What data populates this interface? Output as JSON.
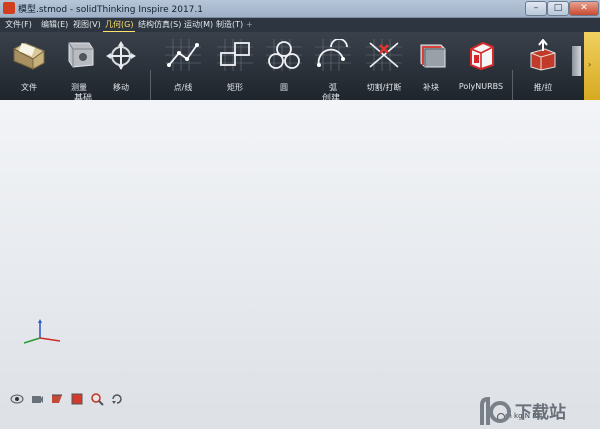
{
  "window": {
    "title": "模型.stmod - solidThinking Inspire 2017.1",
    "min_label": "–",
    "max_label": "□",
    "close_label": "✕"
  },
  "menu": [
    {
      "label": "文件(F)",
      "active": false
    },
    {
      "label": "编辑(E)",
      "active": false
    },
    {
      "label": "视图(V)",
      "active": false
    },
    {
      "label": "几何(G)",
      "active": true
    },
    {
      "label": "结构仿真(S)",
      "active": false
    },
    {
      "label": "运动(M)",
      "active": false
    },
    {
      "label": "制造(T)",
      "active": false
    },
    {
      "label": "+",
      "active": false
    }
  ],
  "ribbon": {
    "tools": [
      {
        "label": "文件",
        "icon": "folder-icon"
      },
      {
        "label": "测量",
        "icon": "measure-icon"
      },
      {
        "label": "移动",
        "icon": "move-icon"
      },
      {
        "label": "点/线",
        "icon": "point-line-icon"
      },
      {
        "label": "矩形",
        "icon": "rectangle-icon"
      },
      {
        "label": "圆",
        "icon": "circle-icon"
      },
      {
        "label": "弧",
        "icon": "arc-icon"
      },
      {
        "label": "切割/打断",
        "icon": "trim-icon"
      },
      {
        "label": "补块",
        "icon": "patch-icon"
      },
      {
        "label": "PolyNURBS",
        "icon": "polynurbs-icon"
      },
      {
        "label": "推/拉",
        "icon": "push-pull-icon"
      }
    ],
    "groups": [
      {
        "label": "基础"
      },
      {
        "label": "创建"
      }
    ],
    "scroll_glyph": "›"
  },
  "statusbar": {
    "units": "m kg N Pa"
  },
  "watermark": {
    "text": "下载站"
  }
}
